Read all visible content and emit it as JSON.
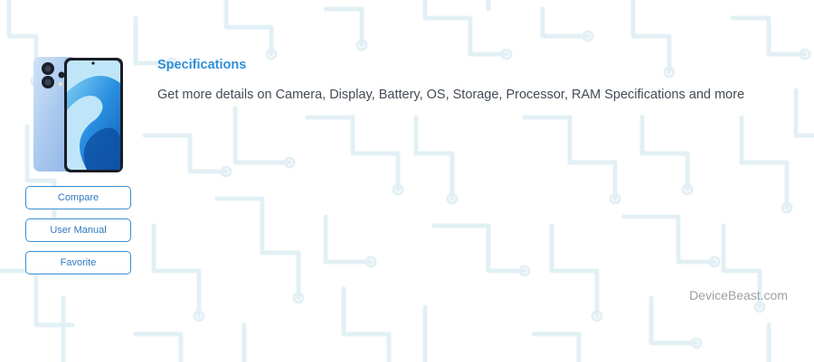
{
  "device": {
    "image_alt": "Phone image"
  },
  "actions": {
    "compare_label": "Compare",
    "manual_label": "User Manual",
    "favorite_label": "Favorite"
  },
  "specifications": {
    "title": "Specifications",
    "description": "Get more details on Camera, Display, Battery, OS, Storage, Processor, RAM Specifications and more"
  },
  "footer": {
    "watermark": "DeviceBeast.com"
  },
  "colors": {
    "accent": "#2e8fd8",
    "button_border": "#3a8ed0",
    "text": "#444b55",
    "watermark": "#9aa0a6",
    "pattern": "#e3f1f6"
  }
}
